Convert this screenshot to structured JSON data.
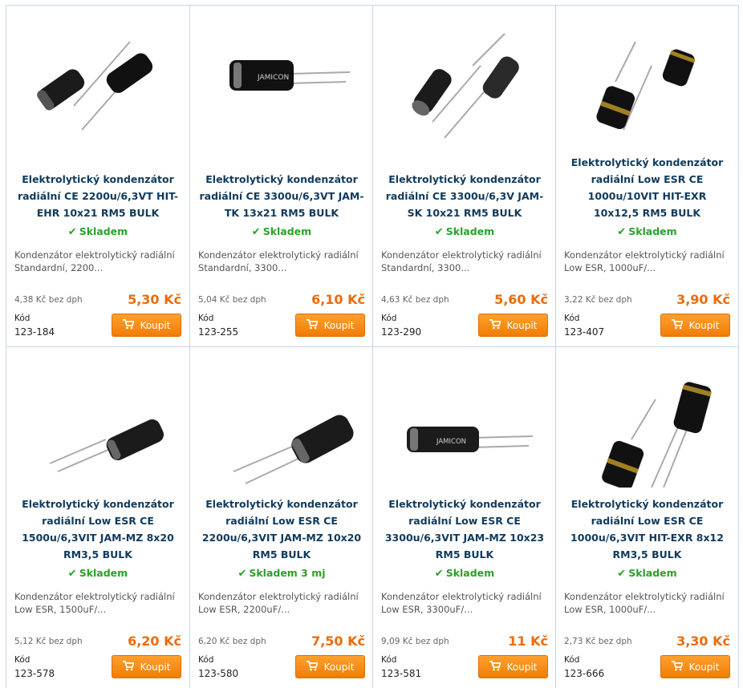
{
  "products": [
    {
      "title": "Elektrolytický kondenzátor radiální CE 2200u/6,3VT HIT-EHR 10x21 RM5 BULK",
      "stock": "Skladem",
      "desc": "Kondenzátor elektrolytický radiální Standardní, 2200...",
      "price_no_vat": "4,38 Kč bez dph",
      "price": "5,30 Kč",
      "code_label": "Kód",
      "code": "123-184",
      "buy_label": "Koupit"
    },
    {
      "title": "Elektrolytický kondenzátor radiální CE 3300u/6,3VT JAM-TK 13x21 RM5 BULK",
      "stock": "Skladem",
      "desc": "Kondenzátor elektrolytický radiální Standardní, 3300...",
      "price_no_vat": "5,04 Kč bez dph",
      "price": "6,10 Kč",
      "code_label": "Kód",
      "code": "123-255",
      "buy_label": "Koupit"
    },
    {
      "title": "Elektrolytický kondenzátor radiální CE 3300u/6,3V JAM-SK 10x21 RM5 BULK",
      "stock": "Skladem",
      "desc": "Kondenzátor elektrolytický radiální Standardní, 3300...",
      "price_no_vat": "4,63 Kč bez dph",
      "price": "5,60 Kč",
      "code_label": "Kód",
      "code": "123-290",
      "buy_label": "Koupit"
    },
    {
      "title": "Elektrolytický kondenzátor radiální Low ESR CE 1000u/10VIT HIT-EXR 10x12,5 RM5 BULK",
      "stock": "Skladem",
      "desc": "Kondenzátor elektrolytický radiální Low ESR, 1000uF/...",
      "price_no_vat": "3,22 Kč bez dph",
      "price": "3,90 Kč",
      "code_label": "Kód",
      "code": "123-407",
      "buy_label": "Koupit"
    },
    {
      "title": "Elektrolytický kondenzátor radiální Low ESR CE 1500u/6,3VIT JAM-MZ 8x20 RM3,5 BULK",
      "stock": "Skladem",
      "desc": "Kondenzátor elektrolytický radiální Low ESR, 1500uF/...",
      "price_no_vat": "5,12 Kč bez dph",
      "price": "6,20 Kč",
      "code_label": "Kód",
      "code": "123-578",
      "buy_label": "Koupit"
    },
    {
      "title": "Elektrolytický kondenzátor radiální Low ESR CE 2200u/6,3VIT JAM-MZ 10x20 RM5 BULK",
      "stock": "Skladem 3 mj",
      "desc": "Kondenzátor elektrolytický radiální Low ESR, 2200uF/...",
      "price_no_vat": "6,20 Kč bez dph",
      "price": "7,50 Kč",
      "code_label": "Kód",
      "code": "123-580",
      "buy_label": "Koupit"
    },
    {
      "title": "Elektrolytický kondenzátor radiální Low ESR CE 3300u/6,3VIT JAM-MZ 10x23 RM5 BULK",
      "stock": "Skladem",
      "desc": "Kondenzátor elektrolytický radiální Low ESR, 3300uF/...",
      "price_no_vat": "9,09 Kč bez dph",
      "price": "11 Kč",
      "code_label": "Kód",
      "code": "123-581",
      "buy_label": "Koupit"
    },
    {
      "title": "Elektrolytický kondenzátor radiální Low ESR CE 1000u/6,3VIT HIT-EXR 8x12 RM3,5 BULK",
      "stock": "Skladem",
      "desc": "Kondenzátor elektrolytický radiální Low ESR, 1000uF/...",
      "price_no_vat": "2,73 Kč bez dph",
      "price": "3,30 Kč",
      "code_label": "Kód",
      "code": "123-666",
      "buy_label": "Koupit"
    }
  ],
  "icons": {
    "stock": "check-icon",
    "cart": "cart-icon",
    "product_image": "capacitor-image"
  },
  "colors": {
    "title": "#103a5c",
    "stock": "#27a327",
    "price": "#ec6b0a",
    "button": "#f58a12",
    "border": "#c7d6e6"
  }
}
